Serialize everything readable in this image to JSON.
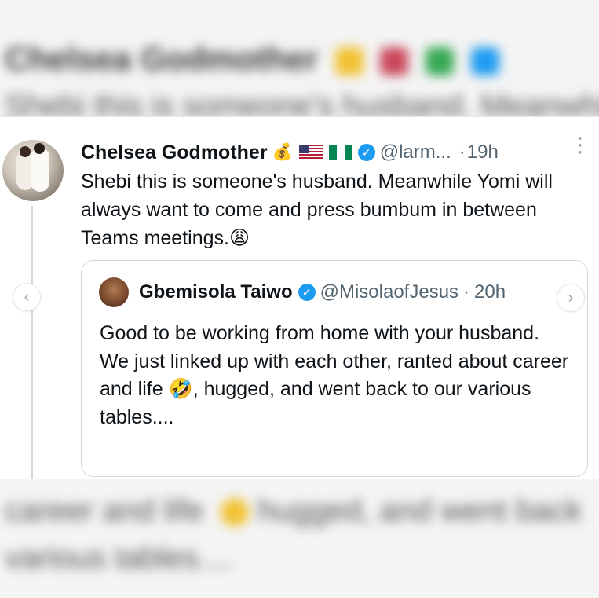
{
  "background": {
    "top_blurred_lines": [
      "Chelsea Godmother",
      "Shebi this is someone's husband. Meanwhile Yomi will"
    ],
    "bottom_blurred_lines": [
      "career and life",
      "hugged, and went back",
      "various tables...."
    ]
  },
  "tweet": {
    "author_name": "Chelsea Godmother",
    "emoji_money": "💰",
    "flag_icons": [
      "flag-us-icon",
      "flag-nigeria-icon"
    ],
    "verified_glyph": "✓",
    "handle": "@larm...",
    "dot": "·",
    "time": "19h",
    "more_glyph": "⋮",
    "text": "Shebi this is someone's husband. Meanwhile Yomi will always want to come and press bumbum in between Teams meetings.😩",
    "colors": {
      "verified": "#1d9bf0",
      "secondary_text": "#536471",
      "thread_line": "#cfd9de"
    }
  },
  "quoted_tweet": {
    "author_name": "Gbemisola Taiwo",
    "verified_glyph": "✓",
    "handle": "@MisolaofJesus",
    "dot": "·",
    "time": "20h",
    "text": "Good to be working from home with your husband.\nWe just linked up with each other, ranted about career and life 🤣, hugged, and went back to our various tables...."
  },
  "navigation": {
    "prev_glyph": "‹",
    "next_glyph": "›"
  }
}
